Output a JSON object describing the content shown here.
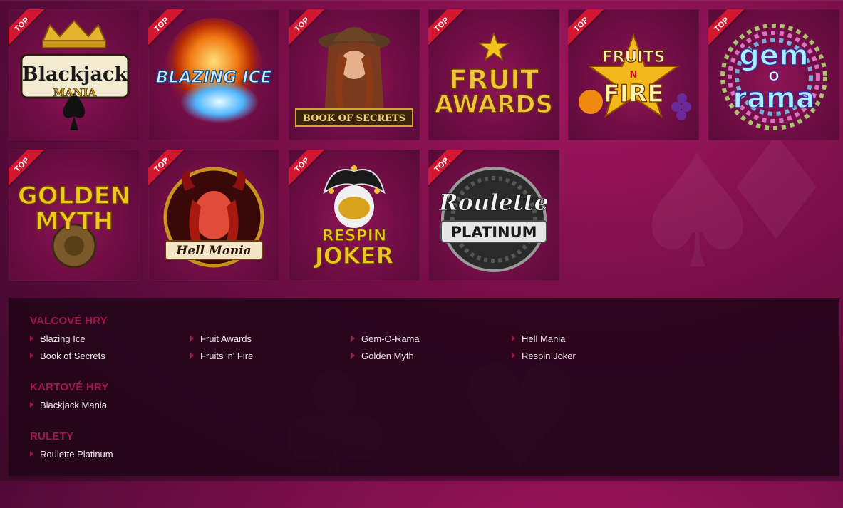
{
  "colors": {
    "accent": "#a3174f",
    "ribbon": "#d31730",
    "background": "#7c0f4a"
  },
  "badge_label": "TOP",
  "tiles": [
    {
      "name": "Blackjack Mania",
      "logo_line1": "Blackjack",
      "logo_line2": "MANIA"
    },
    {
      "name": "Blazing Ice",
      "logo_line1": "BLAZING ICE",
      "logo_line2": ""
    },
    {
      "name": "Book of Secrets",
      "logo_line1": "BOOK OF SECRETS",
      "logo_line2": ""
    },
    {
      "name": "Fruit Awards",
      "logo_line1": "FRUIT",
      "logo_line2": "AWARDS"
    },
    {
      "name": "Fruits 'n' Fire",
      "logo_line1": "FRUITS",
      "logo_line2": "FIRE",
      "logo_mid": "N"
    },
    {
      "name": "Gem-O-Rama",
      "logo_line1": "gem",
      "logo_line2": "rama",
      "logo_mid": "O"
    },
    {
      "name": "Golden Myth",
      "logo_line1": "GOLDEN",
      "logo_line2": "MYTH"
    },
    {
      "name": "Hell Mania",
      "logo_line1": "Hell Mania",
      "logo_line2": ""
    },
    {
      "name": "Respin Joker",
      "logo_line1": "RESPIN",
      "logo_line2": "JOKER"
    },
    {
      "name": "Roulette Platinum",
      "logo_line1": "Roulette",
      "logo_line2": "PLATINUM"
    }
  ],
  "sections": [
    {
      "title": "VALCOVÉ HRY",
      "links": [
        "Blazing Ice",
        "Book of Secrets",
        "Fruit Awards",
        "Fruits 'n' Fire",
        "Gem-O-Rama",
        "Golden Myth",
        "Hell Mania",
        "Respin Joker"
      ]
    },
    {
      "title": "KARTOVÉ HRY",
      "links": [
        "Blackjack Mania"
      ]
    },
    {
      "title": "RULETY",
      "links": [
        "Roulette Platinum"
      ]
    }
  ]
}
